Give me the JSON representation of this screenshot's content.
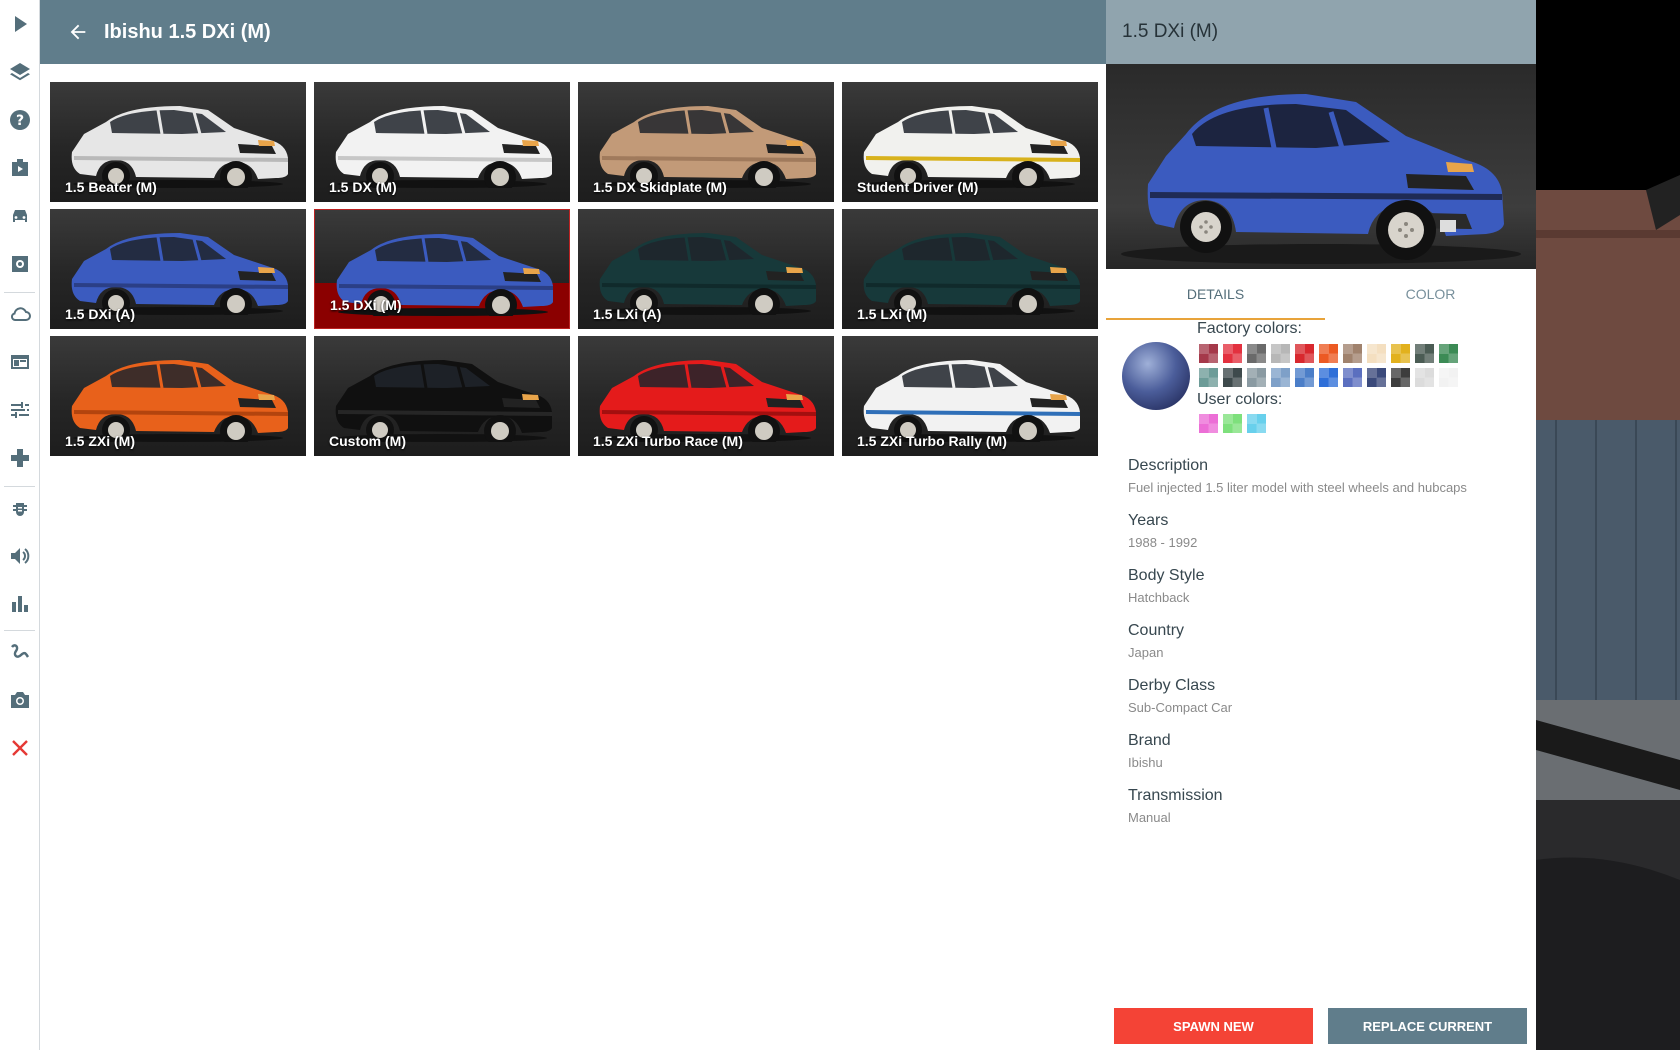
{
  "header": {
    "title": "Ibishu 1.5 DXi (M)"
  },
  "sidebar": {
    "items": [
      {
        "name": "play-icon"
      },
      {
        "name": "layers-icon"
      },
      {
        "name": "help-icon"
      },
      {
        "name": "scenario-icon"
      },
      {
        "name": "car-icon"
      },
      {
        "name": "parts-icon"
      },
      {
        "name": "cloud-icon"
      },
      {
        "name": "window-icon"
      },
      {
        "name": "tune-icon"
      },
      {
        "name": "gamepad-icon"
      },
      {
        "name": "bug-icon"
      },
      {
        "name": "sound-icon"
      },
      {
        "name": "chart-icon"
      },
      {
        "name": "route-icon"
      },
      {
        "name": "camera-icon"
      },
      {
        "name": "close-icon"
      }
    ]
  },
  "configs": [
    {
      "label": "1.5 Beater (M)",
      "body": "#e6e6e6",
      "trim": "#b9b9b9",
      "accent": "#555"
    },
    {
      "label": "1.5 DX (M)",
      "body": "#f2f2f2",
      "trim": "#c7c7c7",
      "accent": "#444"
    },
    {
      "label": "1.5 DX Skidplate (M)",
      "body": "#c29a78",
      "trim": "#a07a5c",
      "accent": "#333"
    },
    {
      "label": "Student Driver (M)",
      "body": "#f1f1ee",
      "trim": "#d8b21c",
      "accent": "#333"
    },
    {
      "label": "1.5 DXi (A)",
      "body": "#3b5bbf",
      "trim": "#2b3f86",
      "accent": "#222"
    },
    {
      "label": "1.5 DXi (M)",
      "body": "#3b5bbf",
      "trim": "#2b3f86",
      "accent": "#222",
      "selected": true
    },
    {
      "label": "1.5 LXi (A)",
      "body": "#17393a",
      "trim": "#102a2b",
      "accent": "#111"
    },
    {
      "label": "1.5 LXi (M)",
      "body": "#17393a",
      "trim": "#102a2b",
      "accent": "#111"
    },
    {
      "label": "1.5 ZXi (M)",
      "body": "#e8611b",
      "trim": "#b3440e",
      "accent": "#222"
    },
    {
      "label": "Custom (M)",
      "body": "#101010",
      "trim": "#262626",
      "accent": "#000"
    },
    {
      "label": "1.5 ZXi Turbo Race (M)",
      "body": "#e41b1b",
      "trim": "#a30f0f",
      "accent": "#222"
    },
    {
      "label": "1.5 ZXi Turbo Rally (M)",
      "body": "#f2f2f2",
      "trim": "#2f6fb8",
      "accent": "#222"
    }
  ],
  "panel": {
    "title": "1.5 DXi (M)",
    "tabs": {
      "details": "DETAILS",
      "color": "COLOR"
    },
    "factory_label": "Factory colors:",
    "user_label": "User colors:",
    "factory_colors": [
      "#a5394a",
      "#e3313f",
      "#6a6a6a",
      "#b7b7b7",
      "#d8282e",
      "#ec5a23",
      "#a0826d",
      "#f4dfc0",
      "#e2b11d",
      "#4b5c54",
      "#3c8b55",
      "#6d9c98",
      "#3e4a4c",
      "#8a9aa2",
      "#7ea0c8",
      "#4b7ec8",
      "#2f6fd8",
      "#5b6fbf",
      "#3b4a7b",
      "#3d3d3d",
      "#dcdcdc",
      "#f2f2f2"
    ],
    "user_colors": [
      "#ec6ed6",
      "#7ee07c",
      "#68d0ec"
    ],
    "details": [
      {
        "label": "Description",
        "value": "Fuel injected 1.5 liter model with steel wheels and hubcaps"
      },
      {
        "label": "Years",
        "value": "1988 - 1992"
      },
      {
        "label": "Body Style",
        "value": "Hatchback"
      },
      {
        "label": "Country",
        "value": "Japan"
      },
      {
        "label": "Derby Class",
        "value": "Sub-Compact Car"
      },
      {
        "label": "Brand",
        "value": "Ibishu"
      },
      {
        "label": "Transmission",
        "value": "Manual"
      }
    ],
    "buttons": {
      "spawn": "SPAWN NEW",
      "replace": "REPLACE CURRENT"
    }
  }
}
